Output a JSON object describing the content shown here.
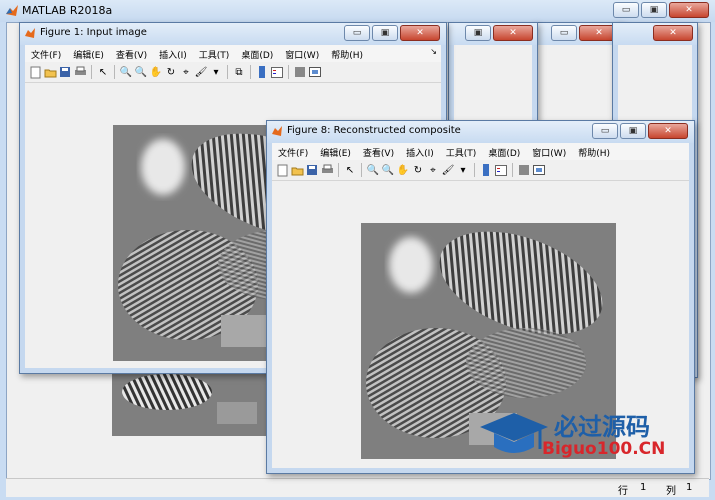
{
  "app": {
    "title": "MATLAB R2018a",
    "status_row_label": "行",
    "status_row_value": "1",
    "status_col_label": "列",
    "status_col_value": "1"
  },
  "window_buttons": {
    "minimize": "▭",
    "restore": "▣",
    "close": "✕"
  },
  "menu": [
    "文件(F)",
    "编辑(E)",
    "查看(V)",
    "插入(I)",
    "工具(T)",
    "桌面(D)",
    "窗口(W)",
    "帮助(H)"
  ],
  "menu_arrow": "↘",
  "figures": {
    "fig1": {
      "title": "Figure 1: Input image"
    },
    "fig8": {
      "title": "Figure 8: Reconstructed composite"
    }
  },
  "watermark": {
    "line1": "必过源码",
    "line2": "Biguo100.CN"
  },
  "colors": {
    "accent": "#1e5fa8",
    "watermark_red": "#d8262b"
  }
}
